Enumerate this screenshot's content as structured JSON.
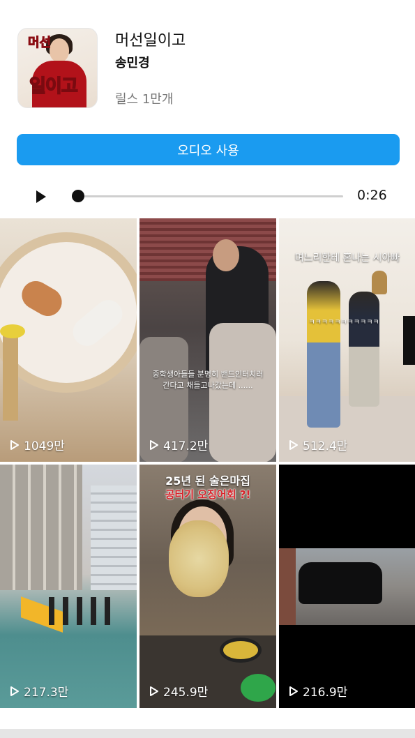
{
  "audio": {
    "title": "머선일이고",
    "artist": "송민경",
    "reels_count": "릴스 1만개",
    "cover_text_top": "머선",
    "cover_text_bottom": "일이고"
  },
  "actions": {
    "use_audio_label": "오디오 사용"
  },
  "player": {
    "play_icon": "play-icon",
    "progress": 0.0,
    "duration": "0:26"
  },
  "reels": [
    {
      "views": "1049만",
      "caption": ""
    },
    {
      "views": "417.2만",
      "caption": "중학생아들들 분명히 밴드인터치러간다고 채들고나갔는데 ......"
    },
    {
      "views": "512.4만",
      "caption": "며느리한테 혼나는 시아빠",
      "caption2": "ㅋㅋㅋㅋㅋㅋㅋㅋㅋㅋㅋ"
    },
    {
      "views": "217.3만",
      "caption": ""
    },
    {
      "views": "245.9만",
      "caption": "25년 된 술은마집",
      "caption2": "공터기 오징어회 ?!"
    },
    {
      "views": "216.9만",
      "caption": ""
    }
  ]
}
